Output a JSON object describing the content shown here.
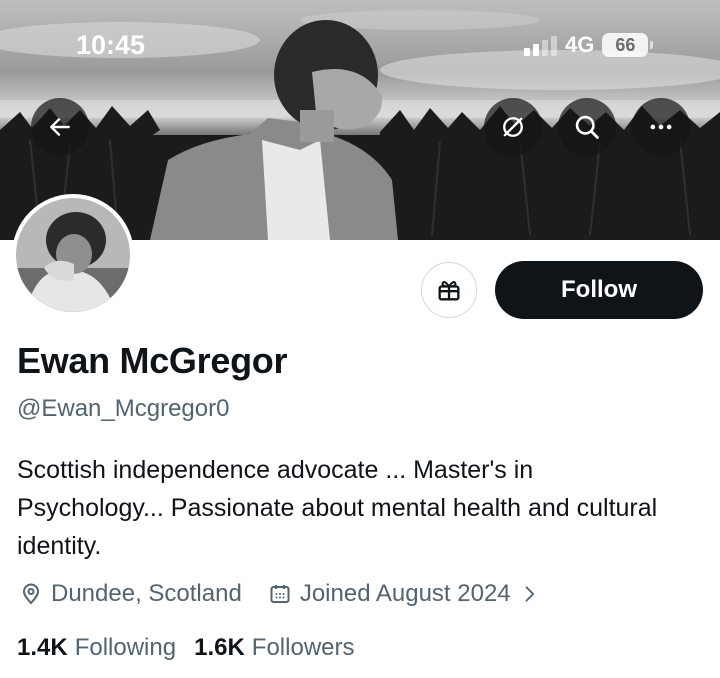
{
  "status_bar": {
    "time": "10:45",
    "network": "4G",
    "battery": "66"
  },
  "profile": {
    "name": "Ewan McGregor",
    "handle": "@Ewan_Mcgregor0",
    "bio": "Scottish independence advocate ... Master's in Psychology... Passionate about mental health and cultural identity.",
    "location": "Dundee, Scotland",
    "joined": "Joined August 2024",
    "following_count": "1.4K",
    "following_label": "Following",
    "followers_count": "1.6K",
    "followers_label": "Followers"
  },
  "actions": {
    "follow_label": "Follow"
  },
  "icons": {
    "back": "back-arrow-icon",
    "translate": "no-translate-icon",
    "search": "search-icon",
    "more": "more-icon",
    "gift": "gift-icon",
    "location": "location-pin-icon",
    "calendar": "calendar-icon",
    "chevron": "chevron-right-icon"
  },
  "colors": {
    "text": "#0f1419",
    "secondary": "#536471",
    "button": "#0f1419"
  }
}
